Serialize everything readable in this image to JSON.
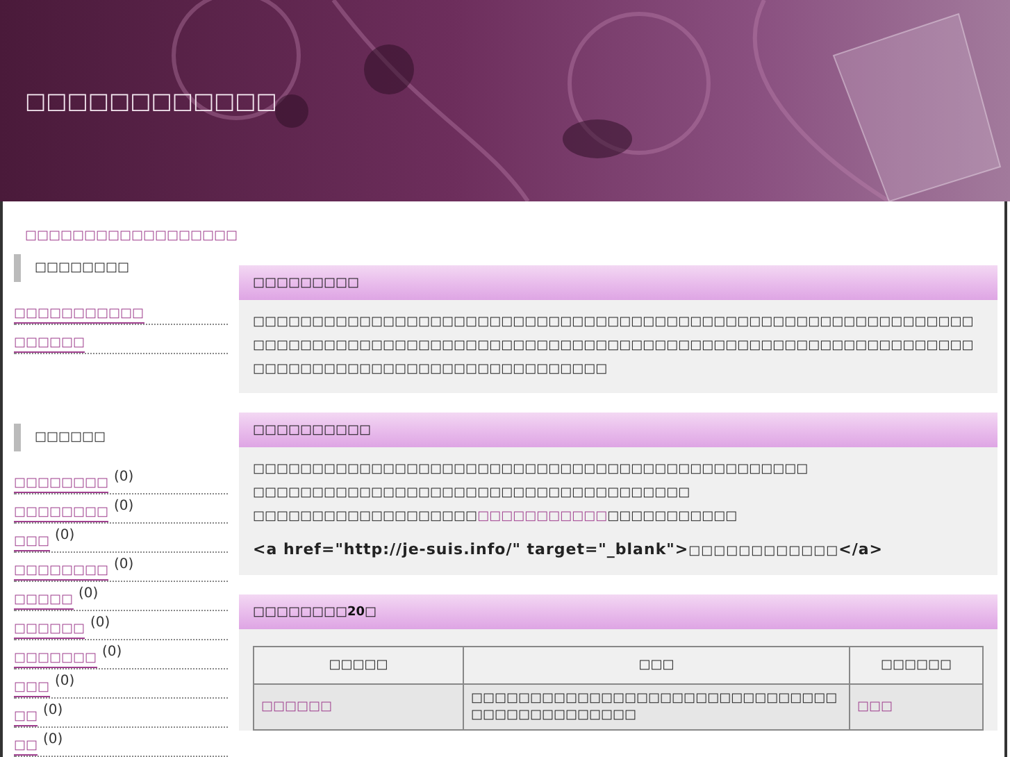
{
  "header": {
    "title": "□□□□□□□□□□□□"
  },
  "breadcrumb": "□□□□□□□□□□□□□□□□□□",
  "sidebar": [
    {
      "heading": "□□□□□□□□",
      "items": [
        {
          "label": "□□□□□□□□□□□"
        },
        {
          "label": "□□□□□□"
        }
      ]
    },
    {
      "heading": "□□□□□□",
      "items": [
        {
          "label": "□□□□□□□□",
          "count": "(0)"
        },
        {
          "label": "□□□□□□□□",
          "count": "(0)"
        },
        {
          "label": "□□□",
          "count": "(0)"
        },
        {
          "label": "□□□□□□□□",
          "count": "(0)"
        },
        {
          "label": "□□□□□",
          "count": "(0)"
        },
        {
          "label": "□□□□□□",
          "count": "(0)"
        },
        {
          "label": "□□□□□□□",
          "count": "(0)"
        },
        {
          "label": "□□□",
          "count": "(0)"
        },
        {
          "label": "□□",
          "count": "(0)"
        },
        {
          "label": "□□",
          "count": "(0)"
        }
      ]
    }
  ],
  "sections": [
    {
      "heading": "□□□□□□□□□",
      "paragraphs": [
        {
          "text": "□□□□□□□□□□□□□□□□□□□□□□□□□□□□□□□□□□□□□□□□□□□□□□□□□□□□□□□□□□□□□□□□□□□□□□□□□□□□□□□□□□□□□□□□□□□□□□□□□□□□□□□□□□□□□□□□□□□□□□□□□□□□□□□□□□□□□□□□□□□□□□□□□□□□□□□□"
        }
      ]
    },
    {
      "heading": "□□□□□□□□□□",
      "lines": [
        [
          {
            "text": "□□□□□□□□□□□□□□□□□□□□□□□□□□□□□□□□□□□□□□□□□□□□□□□"
          }
        ],
        [
          {
            "text": "□□□□□□□□□□□□□□□□□□□□□□□□□□□□□□□□□□□□□"
          }
        ],
        [
          {
            "text": "□□□□□□□□□□□□□□□□□□□"
          },
          {
            "text": "□□□□□□□□□□□",
            "link": true
          },
          {
            "text": "□□□□□□□□□□□"
          }
        ]
      ],
      "code": [
        {
          "text": "<a href=\"http://je-suis.info/\" target=\"_blank\">",
          "bold": true
        },
        {
          "text": "□□□□□□□□□□□□",
          "bold": false
        },
        {
          "text": "</a>",
          "bold": true
        }
      ]
    },
    {
      "heading": "□□□□□□□□20□",
      "table": {
        "columns": [
          "□□□□□",
          "□□□",
          "□□□□□□"
        ],
        "rows": [
          {
            "cells": [
              {
                "text": "□□□□□□",
                "link": true
              },
              {
                "text": "□□□□□□□□□□□□□□□□□□□□□□□□□□□□□□□□□□□□□□□□□□□□□",
                "link": false
              },
              {
                "text": "□□□",
                "link": true
              }
            ]
          }
        ]
      }
    }
  ]
}
